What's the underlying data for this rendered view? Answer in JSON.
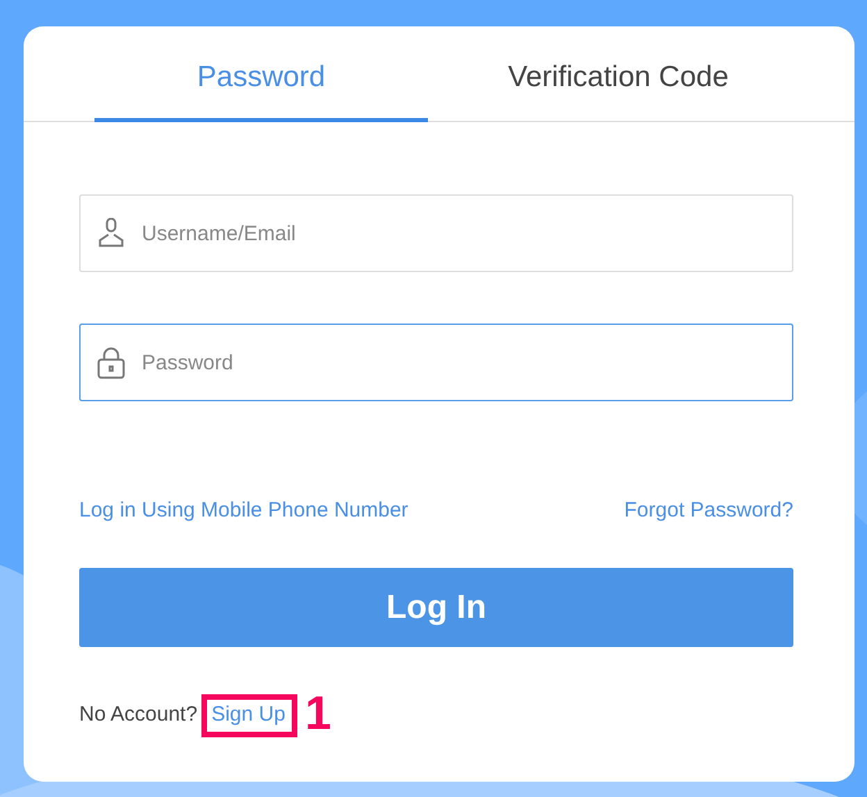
{
  "tabs": [
    {
      "label": "Password",
      "selected": true
    },
    {
      "label": "Verification Code",
      "selected": false
    }
  ],
  "fields": [
    {
      "kind": "user",
      "placeholder": "Username/Email",
      "focused": false
    },
    {
      "kind": "lock",
      "placeholder": "Password",
      "focused": true
    }
  ],
  "links": {
    "mobile_login": "Log in Using Mobile Phone Number",
    "forgot": "Forgot Password?"
  },
  "login_button": "Log In",
  "signup": {
    "prompt": "No Account?",
    "link": "Sign Up"
  },
  "annotation": {
    "number": "1"
  }
}
